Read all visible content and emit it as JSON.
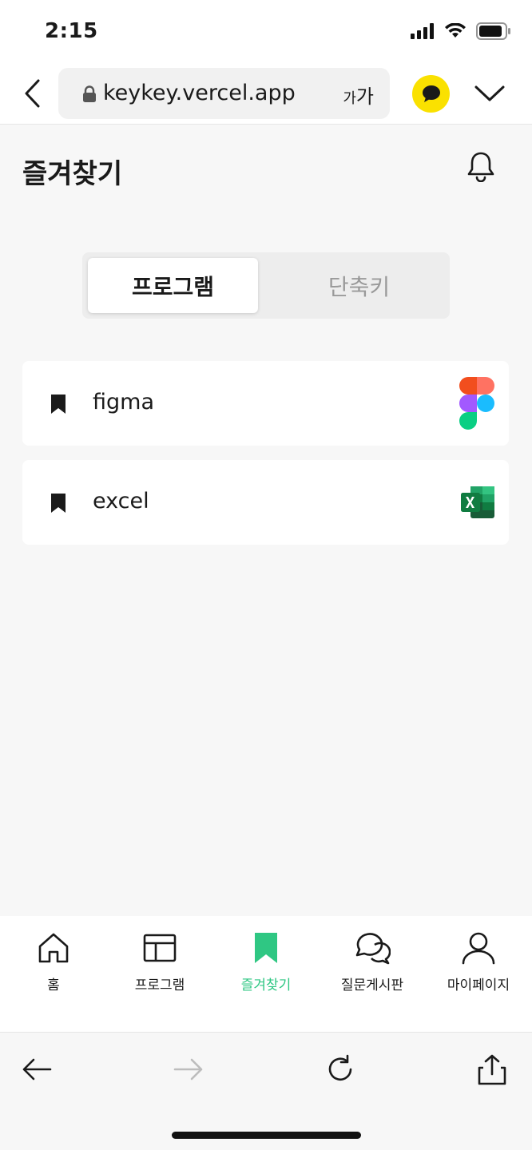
{
  "status_bar": {
    "time": "2:15"
  },
  "browser": {
    "url": "keykey.vercel.app",
    "text_size_small": "가",
    "text_size_large": "가"
  },
  "page": {
    "title": "즐겨찾기"
  },
  "segmented": {
    "tabs": [
      {
        "label": "프로그램",
        "active": true
      },
      {
        "label": "단축키",
        "active": false
      }
    ]
  },
  "favorites": [
    {
      "label": "figma",
      "logo": "figma-logo"
    },
    {
      "label": "excel",
      "logo": "excel-logo"
    }
  ],
  "bottom_nav": {
    "items": [
      {
        "label": "홈",
        "icon": "home-icon"
      },
      {
        "label": "프로그램",
        "icon": "layout-icon"
      },
      {
        "label": "즐겨찾기",
        "icon": "bookmark-icon",
        "active": true
      },
      {
        "label": "질문게시판",
        "icon": "chat-bubbles-icon"
      },
      {
        "label": "마이페이지",
        "icon": "user-icon"
      }
    ]
  },
  "colors": {
    "accent": "#2fc783",
    "kakao_yellow": "#fae100",
    "background": "#f7f7f7"
  }
}
